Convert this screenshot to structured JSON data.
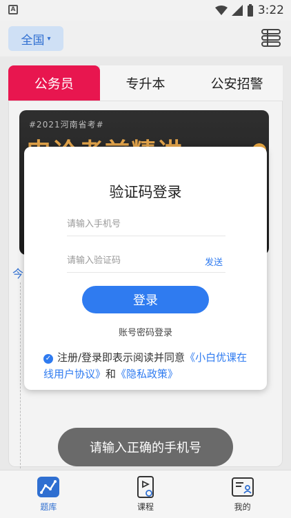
{
  "status_bar": {
    "time": "3:22",
    "app_badge": "A"
  },
  "header": {
    "region_label": "全国",
    "region_caret": "▾"
  },
  "tabs": [
    {
      "label": "公务员",
      "active": true
    },
    {
      "label": "专升本",
      "active": false
    },
    {
      "label": "公安招警",
      "active": false
    }
  ],
  "banner": {
    "tag": "#2021河南省考#",
    "title": "申论考前精讲"
  },
  "side_text": "今",
  "login_modal": {
    "title": "验证码登录",
    "phone_placeholder": "请输入手机号",
    "code_placeholder": "请输入验证码",
    "send_label": "发送",
    "login_label": "登录",
    "password_login_label": "账号密码登录",
    "agreement_prefix": "注册/登录即表示阅读并同意",
    "agreement_link1": "《小白优课在线用户协议》",
    "agreement_and": "和",
    "agreement_link2": "《隐私政策》"
  },
  "toast": "请输入正确的手机号",
  "bottom_nav": [
    {
      "label": "题库",
      "icon": "question-bank-icon",
      "active": true
    },
    {
      "label": "课程",
      "icon": "course-icon",
      "active": false
    },
    {
      "label": "我的",
      "icon": "profile-icon",
      "active": false
    }
  ],
  "colors": {
    "accent": "#2f7bf0",
    "tab_active": "#e8164f",
    "toast_bg": "#6a6a6a"
  }
}
